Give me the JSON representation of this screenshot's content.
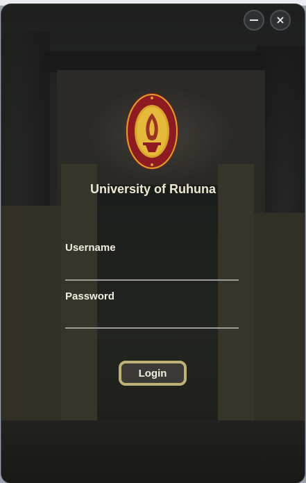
{
  "window": {
    "minimize_label": "—",
    "close_label": "×"
  },
  "header": {
    "university_name": "University of Ruhuna"
  },
  "form": {
    "username_label": "Username",
    "username_value": "",
    "password_label": "Password",
    "password_value": ""
  },
  "actions": {
    "login_label": "Login"
  },
  "colors": {
    "accent_border": "#bdb176",
    "text": "#f2eedf",
    "logo_red": "#8e1b22",
    "logo_gold": "#d8a52a"
  },
  "icons": {
    "minimize": "minimize-icon",
    "close": "close-icon",
    "logo": "university-crest-icon"
  }
}
